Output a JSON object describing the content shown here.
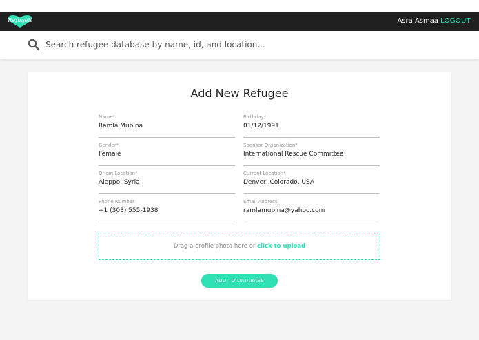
{
  "app": {
    "logo_text": "RefugeIt"
  },
  "header": {
    "user_name": "Asra Asmaa",
    "logout_label": "LOGOUT"
  },
  "search": {
    "placeholder": "Search refugee database by name, id, and location..."
  },
  "form": {
    "title": "Add New Refugee",
    "fields": [
      {
        "label": "Name*",
        "value": "Ramla Mubina"
      },
      {
        "label": "Birthday*",
        "value": "01/12/1991"
      },
      {
        "label": "Gender*",
        "value": "Female"
      },
      {
        "label": "Sponsor Organization*",
        "value": "International Rescue Committee"
      },
      {
        "label": "Origin Location*",
        "value": "Aleppo, Syria"
      },
      {
        "label": "Current Location*",
        "value": "Denver, Colorado, USA"
      },
      {
        "label": "Phone Number",
        "value": "+1 (303) 555-1938"
      },
      {
        "label": "Email Address",
        "value": "ramlamubina@yahoo.com"
      }
    ],
    "dropzone_text": "Drag a profile photo here or ",
    "dropzone_link": "click to upload",
    "submit_label": "ADD TO DATABASE"
  },
  "colors": {
    "accent": "#2ee0b4",
    "navbar": "#1f1f1f",
    "background": "#f4f4f4"
  },
  "icons": {
    "search": "search-icon",
    "logo": "heart-logo-icon"
  }
}
